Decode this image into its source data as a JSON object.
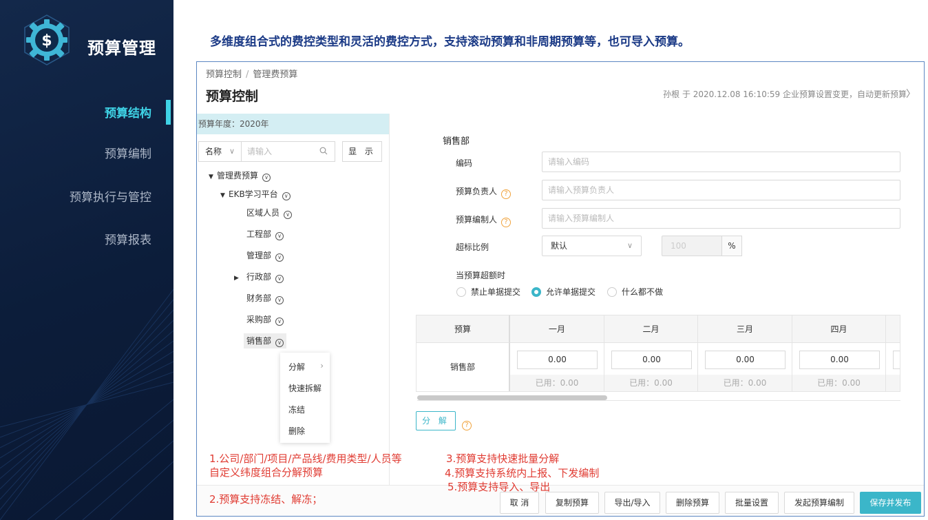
{
  "sidebar": {
    "app_title": "预算管理",
    "items": [
      {
        "label": "预算结构",
        "active": true
      },
      {
        "label": "预算编制",
        "active": false
      },
      {
        "label": "预算执行与管控",
        "active": false
      },
      {
        "label": "预算报表",
        "active": false
      }
    ]
  },
  "headline": "多维度组合式的费控类型和灵活的费控方式，支持滚动预算和非周期预算等，也可导入预算。",
  "header": {
    "breadcrumb": [
      "预算控制",
      "管理费预算"
    ],
    "title": "预算控制",
    "info": "孙根 于 2020.12.08 16:10:59 企业预算设置变更，自动更新预算"
  },
  "tree": {
    "year_label": "预算年度：2020年",
    "search_field": "名称",
    "search_placeholder": "请输入",
    "show_button": "显 示",
    "nodes": [
      {
        "label": "管理费预算"
      },
      {
        "label": "EKB学习平台"
      },
      {
        "label": "区域人员"
      },
      {
        "label": "工程部"
      },
      {
        "label": "管理部"
      },
      {
        "label": "行政部"
      },
      {
        "label": "财务部"
      },
      {
        "label": "采购部"
      },
      {
        "label": "销售部"
      }
    ],
    "context_menu": [
      "分解",
      "快速拆解",
      "冻结",
      "删除"
    ]
  },
  "form": {
    "section_title": "销售部",
    "code_label": "编码",
    "code_placeholder": "请输入编码",
    "owner_label": "预算负责人",
    "owner_placeholder": "请输入预算负责人",
    "editor_label": "预算编制人",
    "editor_placeholder": "请输入预算编制人",
    "ratio_label": "超标比例",
    "ratio_select": "默认",
    "ratio_value": "100",
    "ratio_unit": "%",
    "over_label": "当预算超额时",
    "radios": [
      {
        "label": "禁止单据提交",
        "checked": false
      },
      {
        "label": "允许单据提交",
        "checked": true
      },
      {
        "label": "什么都不做",
        "checked": false
      }
    ]
  },
  "grid": {
    "first_header": "预算",
    "row_label": "销售部",
    "months": [
      {
        "name": "一月",
        "value": "0.00",
        "used": "已用：0.00"
      },
      {
        "name": "二月",
        "value": "0.00",
        "used": "已用：0.00"
      },
      {
        "name": "三月",
        "value": "0.00",
        "used": "已用：0.00"
      },
      {
        "name": "四月",
        "value": "0.00",
        "used": "已用：0.00"
      }
    ],
    "split_button": "分 解"
  },
  "footer": {
    "buttons": [
      "取 消",
      "复制预算",
      "导出/导入",
      "删除预算",
      "批量设置",
      "发起预算编制",
      "保存并发布"
    ]
  },
  "notes": {
    "n1_line1": "1.公司/部门/项目/产品线/费用类型/人员等",
    "n1_line2": "自定义纬度组合分解预算",
    "n2": "2.预算支持冻结、解冻；",
    "n3": "3.预算支持快速批量分解",
    "n4": "4.预算支持系统内上报、下发编制",
    "n5": "5.预算支持导入、导出"
  },
  "colors": {
    "accent": "#3bb6c9",
    "nav_active": "#3fd3e6",
    "note_red": "#e03b32",
    "headline_blue": "#1b3a86",
    "sidebar_bg": "#0c1d3a"
  },
  "icons": [
    "dollar-gear-logo-icon",
    "search-icon",
    "chevron-down-icon",
    "caret-down-icon",
    "caret-right-icon",
    "circle-chevron-icon",
    "help-icon",
    "chevron-right-icon"
  ]
}
